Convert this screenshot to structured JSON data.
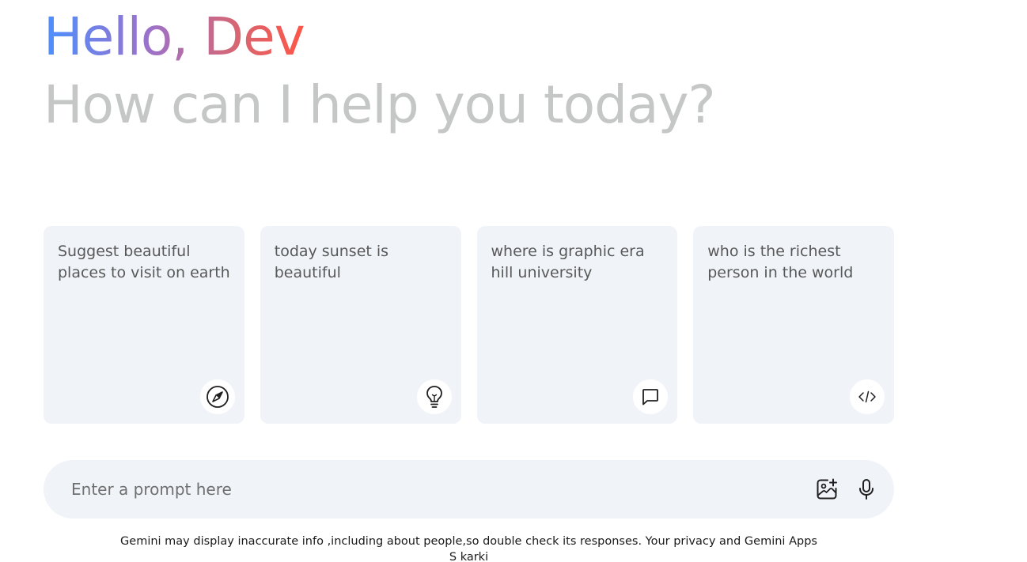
{
  "greeting": {
    "hello": "Hello, Dev",
    "subtitle": "How can I help you today?"
  },
  "cards": [
    {
      "text": "Suggest beautiful places to visit on earth",
      "icon": "compass-icon"
    },
    {
      "text": "today sunset is beautiful",
      "icon": "bulb-icon"
    },
    {
      "text": "where is graphic era hill university",
      "icon": "message-icon"
    },
    {
      "text": "who is the richest person in the world",
      "icon": "code-icon"
    }
  ],
  "prompt": {
    "placeholder": "Enter a prompt here",
    "value": ""
  },
  "actions": {
    "gallery_icon": "gallery-add-icon",
    "mic_icon": "microphone-icon"
  },
  "footer": {
    "disclaimer": "Gemini may display inaccurate info ,including about people,so double check its responses. Your privacy and Gemini Apps",
    "author": "S karki"
  },
  "colors": {
    "card_bg": "#f0f4f9",
    "subtitle": "#c4c7c5",
    "gradient": [
      "#4b90ff",
      "#9b72cb",
      "#d96570",
      "#ff5546"
    ]
  }
}
